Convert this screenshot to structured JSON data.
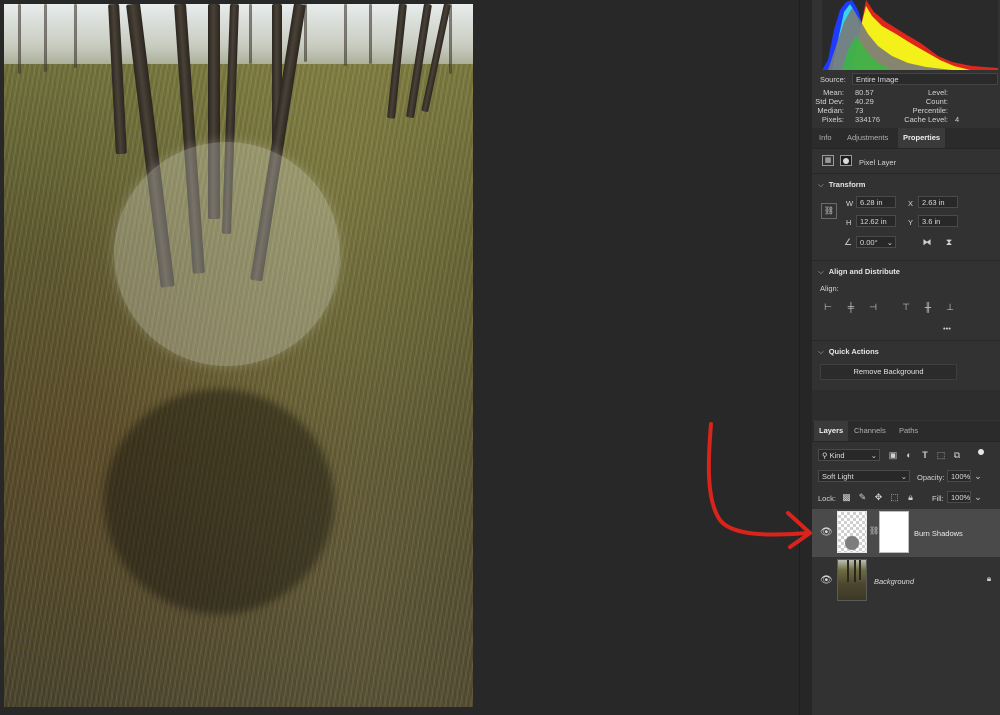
{
  "histogram": {
    "source_label": "Source:",
    "source_value": "Entire Image",
    "stats_left": [
      {
        "label": "Mean:",
        "value": "80.57"
      },
      {
        "label": "Std Dev:",
        "value": "40.29"
      },
      {
        "label": "Median:",
        "value": "73"
      },
      {
        "label": "Pixels:",
        "value": "334176"
      }
    ],
    "stats_right": [
      {
        "label": "Level:",
        "value": ""
      },
      {
        "label": "Count:",
        "value": ""
      },
      {
        "label": "Percentile:",
        "value": ""
      },
      {
        "label": "Cache Level:",
        "value": "4"
      }
    ],
    "colors": {
      "red": "#e0261a",
      "green": "#2fbf3a",
      "blue": "#1e3cff",
      "cyan": "#34d7e8",
      "yellow": "#f3f01a",
      "gray": "#7a7a7a"
    }
  },
  "properties_tabs": [
    {
      "label": "Info",
      "active": false
    },
    {
      "label": "Adjustments",
      "active": false
    },
    {
      "label": "Properties",
      "active": true
    }
  ],
  "properties": {
    "layer_kind": "Pixel Layer",
    "transform": {
      "title": "Transform",
      "w_label": "W",
      "w_value": "6.28 in",
      "x_label": "X",
      "x_value": "2.63 in",
      "h_label": "H",
      "h_value": "12.62 in",
      "y_label": "Y",
      "y_value": "3.6 in",
      "angle_value": "0.00°"
    },
    "align": {
      "title": "Align and Distribute",
      "align_label": "Align:",
      "more": "•••"
    },
    "quick_actions": {
      "title": "Quick Actions",
      "remove_background": "Remove Background"
    }
  },
  "layers_tabs": [
    {
      "label": "Layers",
      "active": true
    },
    {
      "label": "Channels",
      "active": false
    },
    {
      "label": "Paths",
      "active": false
    }
  ],
  "layers_panel": {
    "filter_kind": "Kind",
    "blend_mode": "Soft Light",
    "opacity_label": "Opacity:",
    "opacity_value": "100%",
    "lock_label": "Lock:",
    "fill_label": "Fill:",
    "fill_value": "100%",
    "layers": [
      {
        "name": "Burn Shadows",
        "selected": true,
        "visible": true,
        "locked": false
      },
      {
        "name": "Background",
        "selected": false,
        "visible": true,
        "locked": true
      }
    ]
  },
  "annotation": {
    "arrow_color": "#d9241b"
  }
}
